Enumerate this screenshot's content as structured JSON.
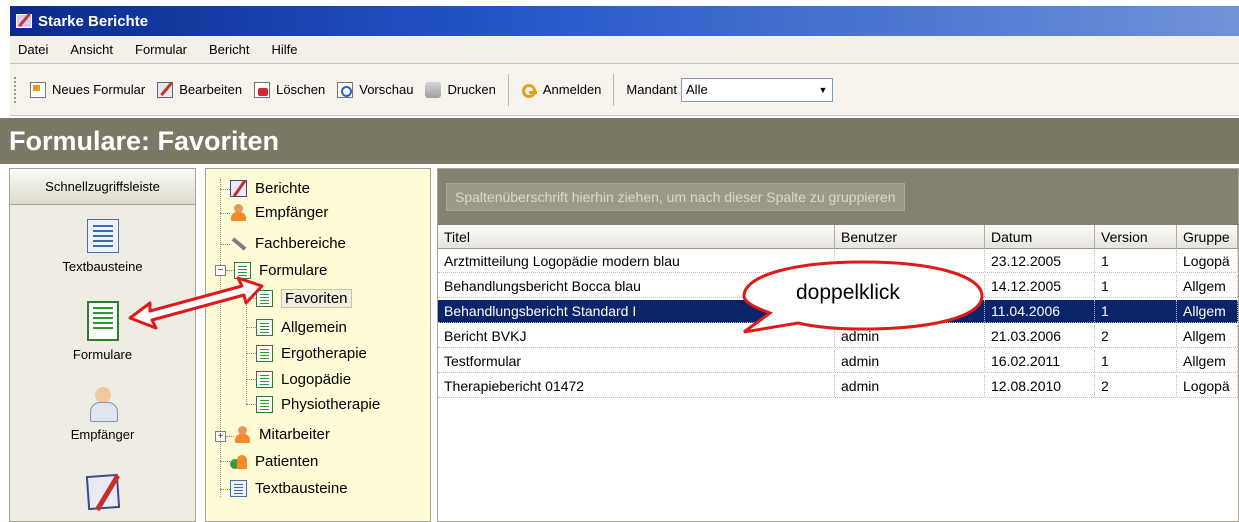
{
  "window": {
    "title": "Starke Berichte"
  },
  "menu": [
    "Datei",
    "Ansicht",
    "Formular",
    "Bericht",
    "Hilfe"
  ],
  "toolbar": {
    "new_form": "Neues Formular",
    "edit": "Bearbeiten",
    "delete": "Löschen",
    "preview": "Vorschau",
    "print": "Drucken",
    "login": "Anmelden",
    "mandant_label": "Mandant",
    "mandant_value": "Alle"
  },
  "page_title": "Formulare: Favoriten",
  "shortcut_bar": {
    "title": "Schnellzugriffsleiste",
    "items": [
      "Textbausteine",
      "Formulare",
      "Empfänger"
    ]
  },
  "tree": {
    "items": [
      "Berichte",
      "Empfänger",
      "Fachbereiche",
      "Formulare",
      "Favoriten",
      "Allgemein",
      "Ergotherapie",
      "Logopädie",
      "Physiotherapie",
      "Mitarbeiter",
      "Patienten",
      "Textbausteine"
    ]
  },
  "grid": {
    "group_hint": "Spaltenüberschrift hierhin ziehen, um nach dieser Spalte zu gruppieren",
    "columns": [
      "Titel",
      "Benutzer",
      "Datum",
      "Version",
      "Gruppe"
    ],
    "rows": [
      [
        "Arztmitteilung Logopädie modern blau",
        "",
        "23.12.2005",
        "1",
        "Logopä"
      ],
      [
        "Behandlungsbericht Bocca blau",
        "",
        "14.12.2005",
        "1",
        "Allgem"
      ],
      [
        "Behandlungsbericht Standard I",
        "admin",
        "11.04.2006",
        "1",
        "Allgem"
      ],
      [
        "Bericht BVKJ",
        "admin",
        "21.03.2006",
        "2",
        "Allgem"
      ],
      [
        "Testformular",
        "admin",
        "16.02.2011",
        "1",
        "Allgem"
      ],
      [
        "Therapiebericht 01472",
        "admin",
        "12.08.2010",
        "2",
        "Logopä"
      ]
    ],
    "selected_row": 2
  },
  "annotation": {
    "callout": "doppelklick"
  },
  "colors": {
    "title_bar": "#0a2a8a",
    "header_band": "#7b7865",
    "selection": "#0a246a",
    "annotation": "#e0191b"
  }
}
